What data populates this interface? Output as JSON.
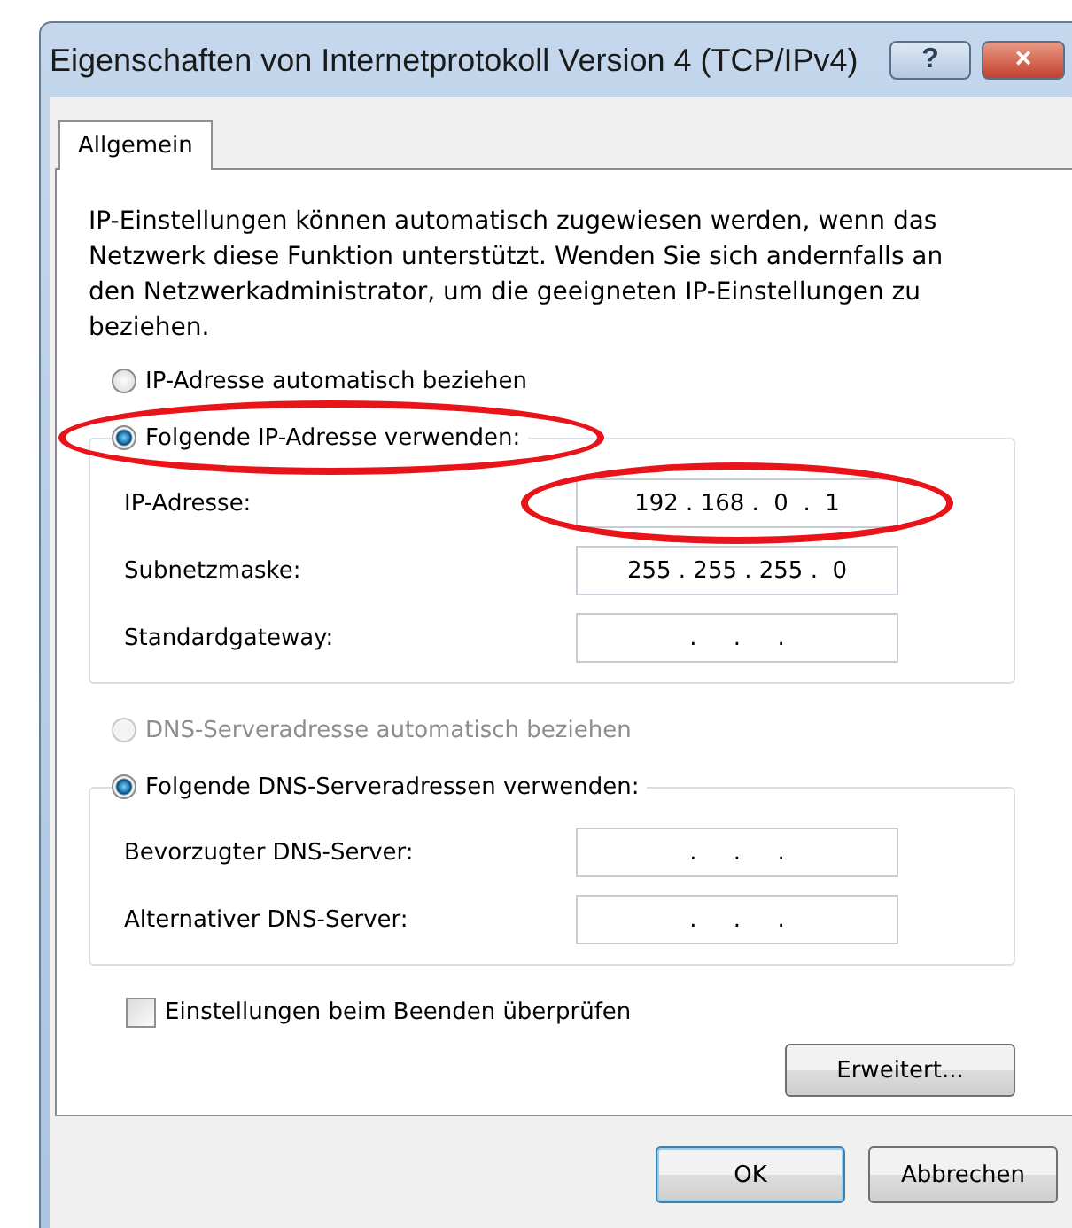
{
  "window": {
    "title": "Eigenschaften von Internetprotokoll Version 4 (TCP/IPv4)",
    "help_button": "?",
    "close_button": "×"
  },
  "tabs": [
    {
      "label": "Allgemein",
      "selected": true
    }
  ],
  "description": "IP-Einstellungen können automatisch zugewiesen werden, wenn das Netzwerk diese Funktion unterstützt. Wenden Sie sich andernfalls an den Netzwerkadministrator, um die geeigneten IP-Einstellungen zu beziehen.",
  "ip_section": {
    "auto_option": {
      "label": "IP-Adresse automatisch beziehen",
      "selected": false,
      "disabled": false,
      "highlighted": false
    },
    "manual_option": {
      "label": "Folgende IP-Adresse verwenden:",
      "selected": true,
      "disabled": false,
      "highlighted": true
    },
    "fields": [
      {
        "label": "IP-Adresse:",
        "value": "192 . 168 .  0  .  1",
        "highlighted": true
      },
      {
        "label": "Subnetzmaske:",
        "value": "255 . 255 . 255 .  0",
        "highlighted": false
      },
      {
        "label": "Standardgateway:",
        "value": ".     .     .",
        "highlighted": false
      }
    ]
  },
  "dns_section": {
    "auto_option": {
      "label": "DNS-Serveradresse automatisch beziehen",
      "selected": false,
      "disabled": true,
      "highlighted": false
    },
    "manual_option": {
      "label": "Folgende DNS-Serveradressen verwenden:",
      "selected": true,
      "disabled": false,
      "highlighted": false
    },
    "fields": [
      {
        "label": "Bevorzugter DNS-Server:",
        "value": ".     .     .",
        "highlighted": false
      },
      {
        "label": "Alternativer DNS-Server:",
        "value": ".     .     .",
        "highlighted": false
      }
    ]
  },
  "validate_checkbox": {
    "label": "Einstellungen beim Beenden überprüfen",
    "checked": false
  },
  "advanced_button": "Erweitert...",
  "buttons": [
    {
      "label": "OK",
      "default": true
    },
    {
      "label": "Abbrechen",
      "default": false
    }
  ]
}
